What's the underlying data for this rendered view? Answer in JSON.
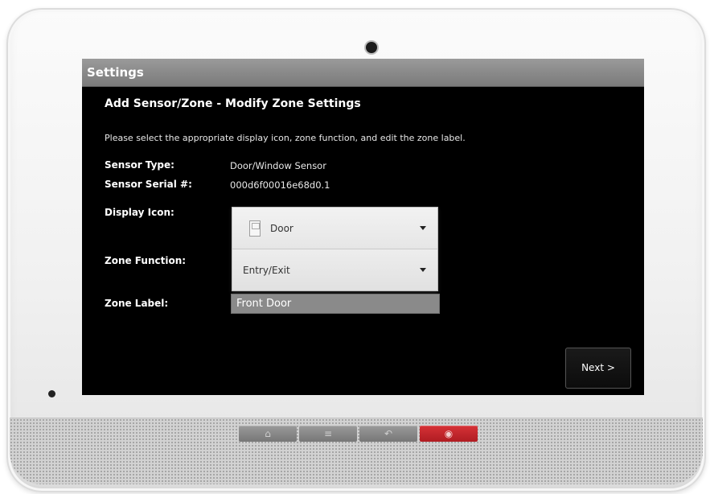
{
  "screen": {
    "title": "Settings",
    "heading": "Add Sensor/Zone - Modify Zone Settings",
    "instruction": "Please select the appropriate display icon, zone function, and edit the zone label."
  },
  "fields": {
    "sensor_type_label": "Sensor Type:",
    "sensor_type_value": "Door/Window Sensor",
    "sensor_serial_label": "Sensor Serial #:",
    "sensor_serial_value": "000d6f00016e68d0.1",
    "display_icon_label": "Display Icon:",
    "display_icon_value": "Door",
    "zone_function_label": "Zone Function:",
    "zone_function_value": "Entry/Exit",
    "zone_label_label": "Zone Label:",
    "zone_label_value": "Front Door"
  },
  "buttons": {
    "next": "Next >"
  },
  "hardware_buttons": [
    {
      "name": "home-hw-button",
      "glyph": "⌂"
    },
    {
      "name": "menu-hw-button",
      "glyph": "≡"
    },
    {
      "name": "back-hw-button",
      "glyph": "↶"
    },
    {
      "name": "emergency-hw-button",
      "glyph": "◉"
    }
  ],
  "colors": {
    "screen_background": "#000000",
    "titlebar": "#8a8a8a",
    "emergency_button": "#c9262c"
  }
}
